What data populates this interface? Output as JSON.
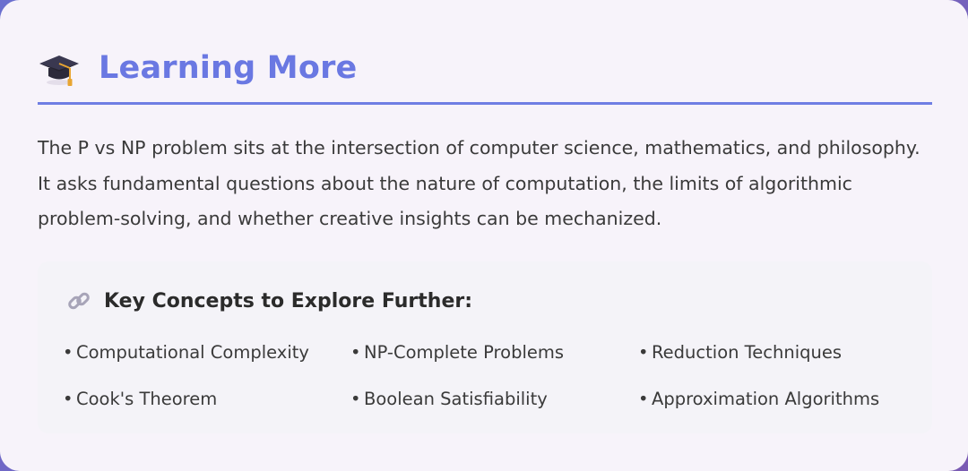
{
  "section": {
    "icon": "graduation-cap-icon",
    "title": "Learning More",
    "accent_color": "#6a78e2"
  },
  "intro": {
    "text": "The P vs NP problem sits at the intersection of computer science, mathematics, and philosophy. It asks fundamental questions about the nature of computation, the limits of algorithmic problem-solving, and whether creative insights can be mechanized."
  },
  "concepts": {
    "icon": "link-icon",
    "title": "Key Concepts to Explore Further:",
    "bullet": "•",
    "items": [
      "Computational Complexity",
      "NP-Complete Problems",
      "Reduction Techniques",
      "Cook's Theorem",
      "Boolean Satisfiability",
      "Approximation Algorithms"
    ]
  }
}
